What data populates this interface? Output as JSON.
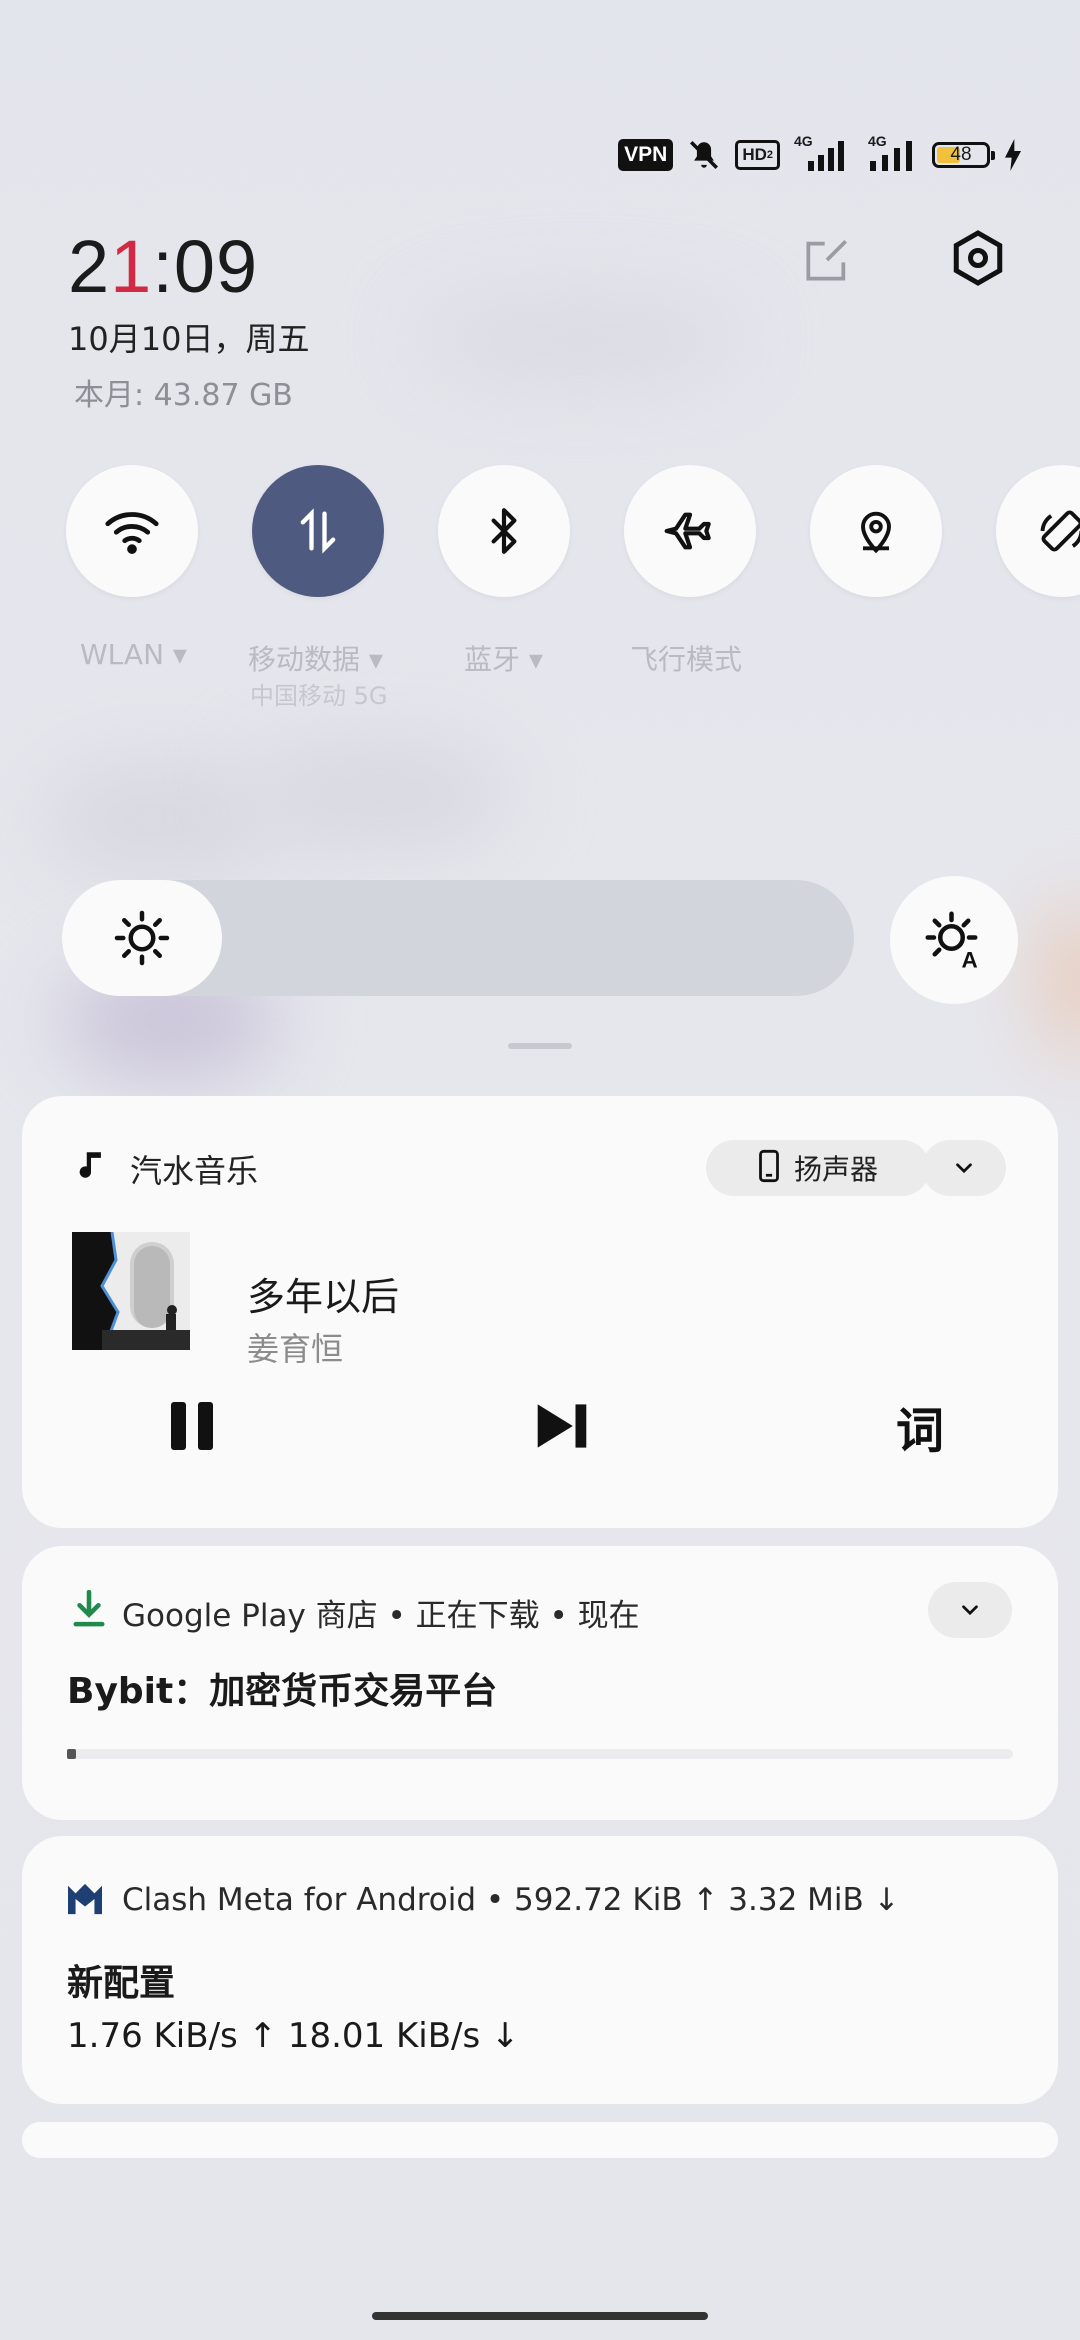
{
  "status_bar": {
    "vpn": "VPN",
    "hd": "HD",
    "hd_sub": "2",
    "net1": "4G",
    "net2": "4G",
    "battery": "48",
    "battery_level": 0.48
  },
  "header": {
    "clock_hour_a": "2",
    "clock_hour_b": "1",
    "clock_rest": ":09",
    "date": "10月10日，周五",
    "data_usage": "本月: 43.87 GB"
  },
  "quick_tiles": [
    {
      "label": "WLAN ▾",
      "icon": "wifi-icon"
    },
    {
      "label": "移动数据 ▾",
      "sublabel": "中国移动 5G",
      "icon": "mobile-data-icon"
    },
    {
      "label": "蓝牙 ▾",
      "icon": "bluetooth-icon"
    },
    {
      "label": "飞行模式",
      "icon": "airplane-icon"
    },
    {
      "label": "",
      "icon": "location-icon"
    },
    {
      "label": "",
      "icon": "auto-rotate-icon"
    }
  ],
  "brightness": {
    "level": 0.2
  },
  "media": {
    "app": "汽水音乐",
    "output": "扬声器",
    "title": "多年以后",
    "artist": "姜育恒",
    "lyrics": "词"
  },
  "google_play": {
    "header": "Google Play 商店 • 正在下载 • 现在",
    "title": "Bybit：加密货币交易平台",
    "progress": 0.01
  },
  "clash": {
    "header": "Clash Meta for Android • 592.72 KiB ↑ 3.32 MiB ↓",
    "title": "新配置",
    "body": "1.76 KiB/s ↑ 18.01 KiB/s ↓"
  },
  "colors": {
    "accent": "#d12a42",
    "tile_active": "#4f5a80",
    "download_green": "#1f8a4c"
  }
}
